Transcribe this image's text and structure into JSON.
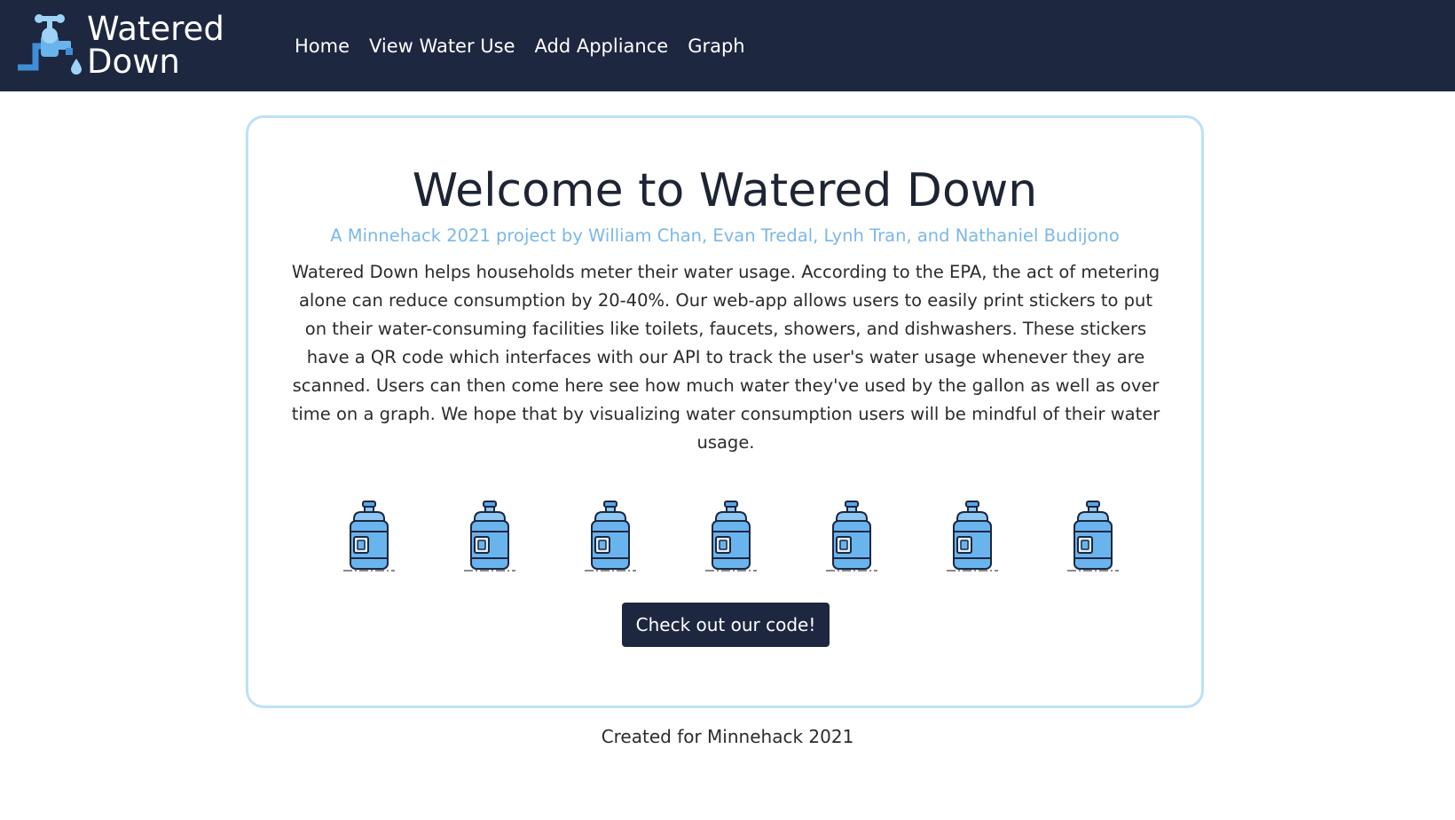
{
  "navbar": {
    "brand": {
      "line1": "Watered",
      "line2": "Down",
      "logo_icon": "faucet-drop-icon"
    },
    "links": [
      {
        "label": "Home"
      },
      {
        "label": "View Water Use"
      },
      {
        "label": "Add Appliance"
      },
      {
        "label": "Graph"
      }
    ]
  },
  "main": {
    "title": "Welcome to Watered Down",
    "subtitle": "A Minnehack 2021 project by William Chan, Evan Tredal, Lynh Tran, and Nathaniel Budijono",
    "description": "Watered Down helps households meter their water usage. According to the EPA, the act of metering alone can reduce consumption by 20-40%. Our web-app allows users to easily print stickers to put on their water-consuming facilities like toilets, faucets, showers, and dishwashers. These stickers have a QR code which interfaces with our API to track the user's water usage whenever they are scanned. Users can then come here see how much water they've used by the gallon as well as over time on a graph. We hope that by visualizing water consumption users will be mindful of their water usage.",
    "bottle_icon": "water-jug-icon",
    "bottle_count": 7,
    "button_label": "Check out our code!"
  },
  "footer": {
    "text": "Created for Minnehack 2021"
  },
  "colors": {
    "navbar_bg": "#1d2740",
    "accent_blue": "#7bb7ea",
    "card_border": "#bde0f8",
    "button_bg": "#1d2740"
  }
}
